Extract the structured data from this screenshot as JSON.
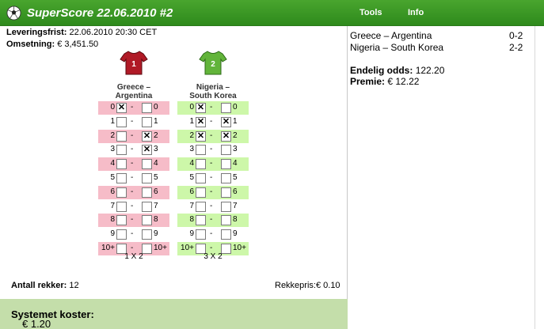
{
  "app": {
    "title": "SuperScore 22.06.2010 #2"
  },
  "menu": {
    "tools": "Tools",
    "info": "Info"
  },
  "info": {
    "leveringsfrist_label": "Leveringsfrist:",
    "leveringsfrist_value": "22.06.2010 20:30 CET",
    "omsetning_label": "Omsetning:",
    "omsetning_value": "€ 3,451.50"
  },
  "matches": [
    {
      "shirt_number": "1",
      "shirt_color": "#b01a26",
      "name_line1": "Greece –",
      "name_line2": "Argentina",
      "row_colors": [
        "pink",
        "plain",
        "pink",
        "plain",
        "pink",
        "plain",
        "pink",
        "plain",
        "pink",
        "plain",
        "pink"
      ],
      "rows": [
        {
          "l": "0",
          "r": "0",
          "cl": true,
          "cr": false
        },
        {
          "l": "1",
          "r": "1",
          "cl": false,
          "cr": false
        },
        {
          "l": "2",
          "r": "2",
          "cl": false,
          "cr": true
        },
        {
          "l": "3",
          "r": "3",
          "cl": false,
          "cr": true
        },
        {
          "l": "4",
          "r": "4",
          "cl": false,
          "cr": false
        },
        {
          "l": "5",
          "r": "5",
          "cl": false,
          "cr": false
        },
        {
          "l": "6",
          "r": "6",
          "cl": false,
          "cr": false
        },
        {
          "l": "7",
          "r": "7",
          "cl": false,
          "cr": false
        },
        {
          "l": "8",
          "r": "8",
          "cl": false,
          "cr": false
        },
        {
          "l": "9",
          "r": "9",
          "cl": false,
          "cr": false
        },
        {
          "l": "10+",
          "r": "10+",
          "cl": false,
          "cr": false
        }
      ],
      "code": "1 X 2"
    },
    {
      "shirt_number": "2",
      "shirt_color": "#62b43a",
      "name_line1": "Nigeria –",
      "name_line2": "South Korea",
      "row_colors": [
        "green",
        "plain",
        "green",
        "plain",
        "green",
        "plain",
        "green",
        "plain",
        "green",
        "plain",
        "green"
      ],
      "rows": [
        {
          "l": "0",
          "r": "0",
          "cl": true,
          "cr": false
        },
        {
          "l": "1",
          "r": "1",
          "cl": true,
          "cr": true
        },
        {
          "l": "2",
          "r": "2",
          "cl": true,
          "cr": true
        },
        {
          "l": "3",
          "r": "3",
          "cl": false,
          "cr": false
        },
        {
          "l": "4",
          "r": "4",
          "cl": false,
          "cr": false
        },
        {
          "l": "5",
          "r": "5",
          "cl": false,
          "cr": false
        },
        {
          "l": "6",
          "r": "6",
          "cl": false,
          "cr": false
        },
        {
          "l": "7",
          "r": "7",
          "cl": false,
          "cr": false
        },
        {
          "l": "8",
          "r": "8",
          "cl": false,
          "cr": false
        },
        {
          "l": "9",
          "r": "9",
          "cl": false,
          "cr": false
        },
        {
          "l": "10+",
          "r": "10+",
          "cl": false,
          "cr": false
        }
      ],
      "code": "3 X 2"
    }
  ],
  "summary": {
    "rekker_label": "Antall rekker:",
    "rekker_value": "12",
    "rekkepris_label": "Rekkepris:",
    "rekkepris_value": "€ 0.10",
    "cost_label": "Systemet koster:",
    "cost_value": "€ 1.20"
  },
  "results": {
    "items": [
      {
        "match": "Greece – Argentina",
        "score": "0-2"
      },
      {
        "match": "Nigeria – South Korea",
        "score": "2-2"
      }
    ],
    "odds_label": "Endelig odds:",
    "odds_value": "122.20",
    "premie_label": "Premie:",
    "premie_value": "€ 12.22"
  },
  "colors": {
    "header_green": "#3a9a25",
    "pink_row": "#f6bcc8",
    "green_row": "#cdf7a9",
    "cost_bg": "#c4deaa"
  },
  "icons": {
    "logo": "soccer-ball-icon",
    "checked": "x-mark-icon",
    "shirt": "jersey-icon"
  }
}
